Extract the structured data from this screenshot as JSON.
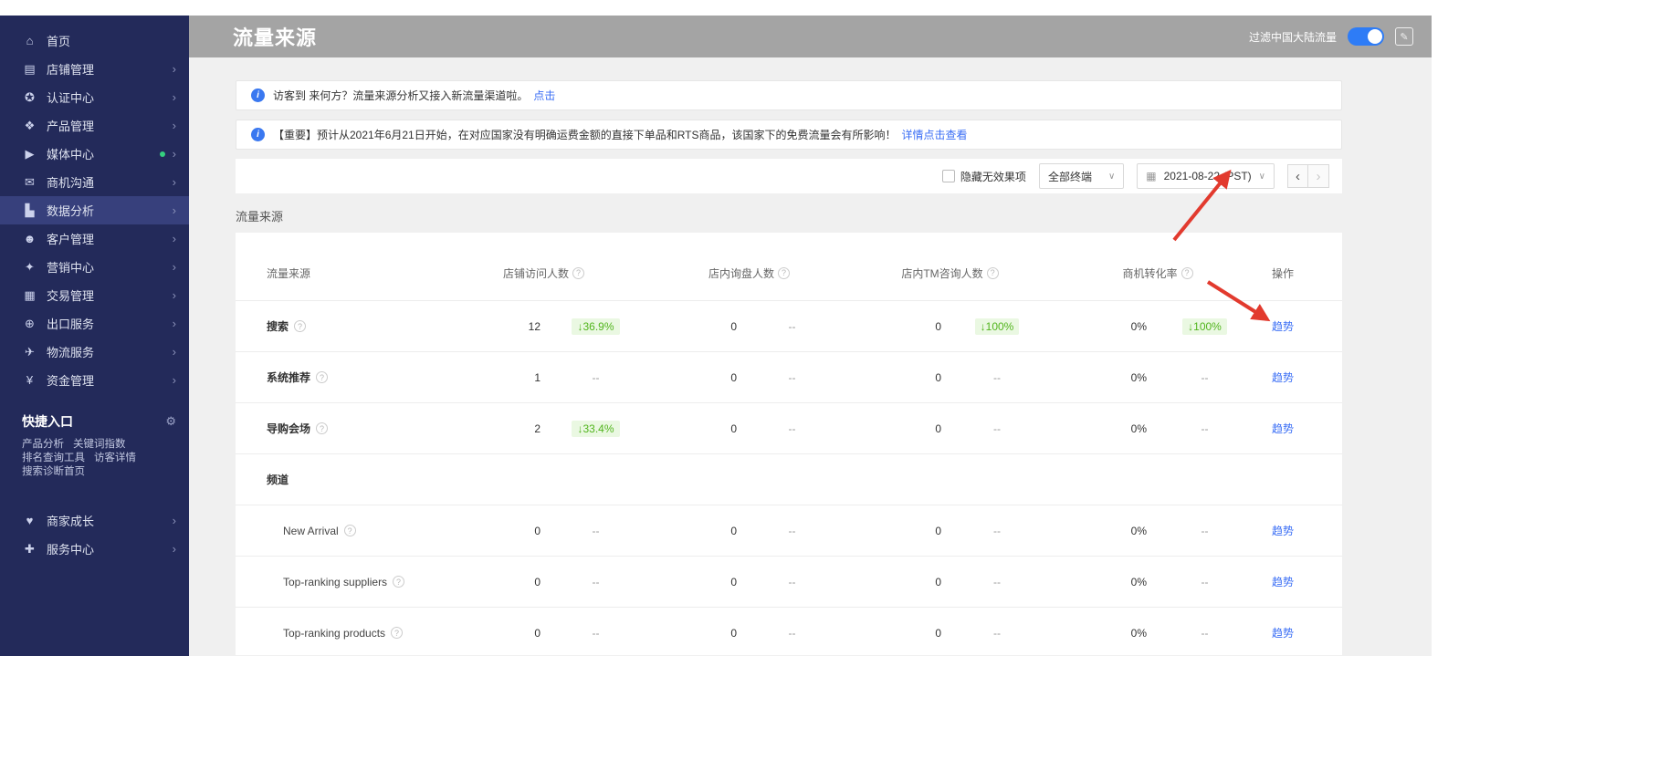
{
  "sidebar": {
    "items": [
      {
        "label": "首页",
        "icon": "home",
        "glyph": "⌂",
        "expandable": false
      },
      {
        "label": "店铺管理",
        "icon": "shop",
        "glyph": "▤",
        "expandable": true
      },
      {
        "label": "认证中心",
        "icon": "certification",
        "glyph": "✪",
        "expandable": true
      },
      {
        "label": "产品管理",
        "icon": "product",
        "glyph": "❖",
        "expandable": true
      },
      {
        "label": "媒体中心",
        "icon": "media",
        "glyph": "▶",
        "expandable": true,
        "dot": true
      },
      {
        "label": "商机沟通",
        "icon": "chat",
        "glyph": "✉",
        "expandable": true
      },
      {
        "label": "数据分析",
        "icon": "data-analysis",
        "glyph": "▙",
        "expandable": true,
        "active": true
      },
      {
        "label": "客户管理",
        "icon": "customer",
        "glyph": "☻",
        "expandable": true
      },
      {
        "label": "营销中心",
        "icon": "marketing",
        "glyph": "✦",
        "expandable": true
      },
      {
        "label": "交易管理",
        "icon": "trade",
        "glyph": "▦",
        "expandable": true
      },
      {
        "label": "出口服务",
        "icon": "export",
        "glyph": "⊕",
        "expandable": true
      },
      {
        "label": "物流服务",
        "icon": "logistics",
        "glyph": "✈",
        "expandable": true
      },
      {
        "label": "资金管理",
        "icon": "funds",
        "glyph": "¥",
        "expandable": true
      }
    ],
    "quick_entry": {
      "title": "快捷入口",
      "gear": "⚙",
      "links": [
        "产品分析",
        "关键词指数",
        "排名查询工具",
        "访客详情",
        "搜索诊断首页"
      ]
    },
    "bottom_items": [
      {
        "label": "商家成长",
        "icon": "merchant-growth",
        "glyph": "♥",
        "expandable": true
      },
      {
        "label": "服务中心",
        "icon": "service-center",
        "glyph": "✚",
        "expandable": true
      }
    ]
  },
  "header": {
    "title": "流量来源",
    "filter_label": "过滤中国大陆流量",
    "toggle_on": true
  },
  "notices": [
    {
      "text": "访客到 来何方？流量来源分析又接入新流量渠道啦。",
      "link": "点击"
    },
    {
      "text": "【重要】预计从2021年6月21日开始，在对应国家没有明确运费金额的直接下单品和RTS商品，该国家下的免费流量会有所影响！",
      "link": "详情点击查看"
    }
  ],
  "toolbar": {
    "hide_checkbox_label": "隐藏无效果项",
    "terminal_select": "全部终端",
    "date_value": "2021-08-22 (PST)",
    "prev": "‹",
    "next": "›"
  },
  "section_title": "流量来源",
  "table": {
    "columns": [
      "流量来源",
      "店铺访问人数",
      "店内询盘人数",
      "店内TM咨询人数",
      "商机转化率",
      "操作"
    ],
    "rows": [
      {
        "name": "搜索",
        "help": true,
        "cells": [
          {
            "v": "12",
            "trend": "36.9%",
            "dir": "down"
          },
          {
            "v": "0",
            "trend": "--"
          },
          {
            "v": "0",
            "trend": "100%",
            "dir": "down"
          },
          {
            "v": "0%",
            "trend": "100%",
            "dir": "down"
          }
        ],
        "action": "趋势"
      },
      {
        "name": "系统推荐",
        "help": true,
        "cells": [
          {
            "v": "1",
            "trend": "--"
          },
          {
            "v": "0",
            "trend": "--"
          },
          {
            "v": "0",
            "trend": "--"
          },
          {
            "v": "0%",
            "trend": "--"
          }
        ],
        "action": "趋势"
      },
      {
        "name": "导购会场",
        "help": true,
        "cells": [
          {
            "v": "2",
            "trend": "33.4%",
            "dir": "down"
          },
          {
            "v": "0",
            "trend": "--"
          },
          {
            "v": "0",
            "trend": "--"
          },
          {
            "v": "0%",
            "trend": "--"
          }
        ],
        "action": "趋势"
      },
      {
        "name": "频道",
        "group": true
      },
      {
        "name": "New Arrival",
        "help": true,
        "sub": true,
        "cells": [
          {
            "v": "0",
            "trend": "--"
          },
          {
            "v": "0",
            "trend": "--"
          },
          {
            "v": "0",
            "trend": "--"
          },
          {
            "v": "0%",
            "trend": "--"
          }
        ],
        "action": "趋势"
      },
      {
        "name": "Top-ranking suppliers",
        "help": true,
        "sub": true,
        "cells": [
          {
            "v": "0",
            "trend": "--"
          },
          {
            "v": "0",
            "trend": "--"
          },
          {
            "v": "0",
            "trend": "--"
          },
          {
            "v": "0%",
            "trend": "--"
          }
        ],
        "action": "趋势"
      },
      {
        "name": "Top-ranking products",
        "help": true,
        "sub": true,
        "cells": [
          {
            "v": "0",
            "trend": "--"
          },
          {
            "v": "0",
            "trend": "--"
          },
          {
            "v": "0",
            "trend": "--"
          },
          {
            "v": "0%",
            "trend": "--"
          }
        ],
        "action": "趋势"
      }
    ]
  },
  "colors": {
    "sidebar_bg": "#232a5a",
    "header_bg": "#a4a4a4",
    "accent_blue": "#3a6ef5",
    "trend_green": "#52b51e",
    "toggle_blue": "#2e7cf6",
    "arrow_red": "#e23a2e"
  }
}
